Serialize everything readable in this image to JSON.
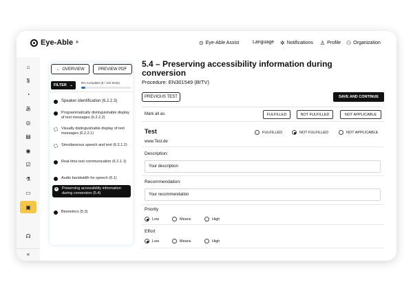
{
  "app": {
    "brand": "Eye-Able",
    "brand_mark": "®"
  },
  "topnav": [
    {
      "label": "Eye-Able Assist",
      "icon": "assist-icon"
    },
    {
      "label": "Language",
      "icon": ""
    },
    {
      "label": "Notifications",
      "icon": "bell-icon"
    },
    {
      "label": "Profile",
      "icon": "user-icon"
    },
    {
      "label": "Organization",
      "icon": "organization-icon"
    }
  ],
  "sidebar": {
    "icons": [
      "home-icon",
      "dollar-icon",
      "pie-chart-icon",
      "translate-icon",
      "fingerprint-icon",
      "clipboard-icon",
      "target-icon",
      "document-check-icon",
      "flask-icon",
      "file-icon",
      "clipboard-active-icon"
    ],
    "bottom_icons": [
      "headset-icon",
      "collapse-icon"
    ]
  },
  "panel": {
    "overview_label": "OVERVIEW",
    "pdf_label": "PREVIEW PDF",
    "filter_label": "FILTER",
    "progress_text": "8% Complete (8 / 104 tests)",
    "progress_fraction": 0.08,
    "items": [
      {
        "label": "Speaker identification (6.2.2.3)",
        "status": "filled"
      },
      {
        "label": "Programmatically distinguishable display of text messages (6.2.2.2)",
        "status": "filled"
      },
      {
        "label": "Visually distinguishable display of text messages (6.2.2.1)",
        "status": "dashed"
      },
      {
        "label": "Simultaneous speech and text (6.2.1.2)",
        "status": "dashed"
      },
      {
        "label": "Real-time text communication (6.2.1.1)",
        "status": "filled"
      },
      {
        "label": "Audio bandwidth for speech (6.1)",
        "status": "filled"
      },
      {
        "label": "Preserving accessibility information during conversion (5.4)",
        "status": "active"
      },
      {
        "label": "Biometrics (5.3)",
        "status": "filled"
      }
    ]
  },
  "main": {
    "title": "5.4 – Preserving accessibility information during conversion",
    "procedure": "Procedure: EN301549 (BITV)",
    "prev_label": "PREVIOUS TEST",
    "save_label": "SAVE AND CONTINUE",
    "mark_all_label": "Mark all as:",
    "mark_buttons": [
      "FULFILLED",
      "NOT FULFILLED",
      "NOT APPLICABLE"
    ],
    "test_title": "Test",
    "test_options": [
      "FULFILLED",
      "NOT FULFILLED",
      "NOT APPLICABLE"
    ],
    "test_selected": "NOT FULFILLED",
    "url": "www.Test.de",
    "description_label": "Description:",
    "description_value": "Your description",
    "recommendation_label": "Recommendation:",
    "recommendation_value": "Your recommendation",
    "priority_label": "Priority",
    "effort_label": "Effort",
    "levels": [
      "Low",
      "Means",
      "High"
    ],
    "priority_selected": "Low",
    "effort_selected": "Low"
  }
}
